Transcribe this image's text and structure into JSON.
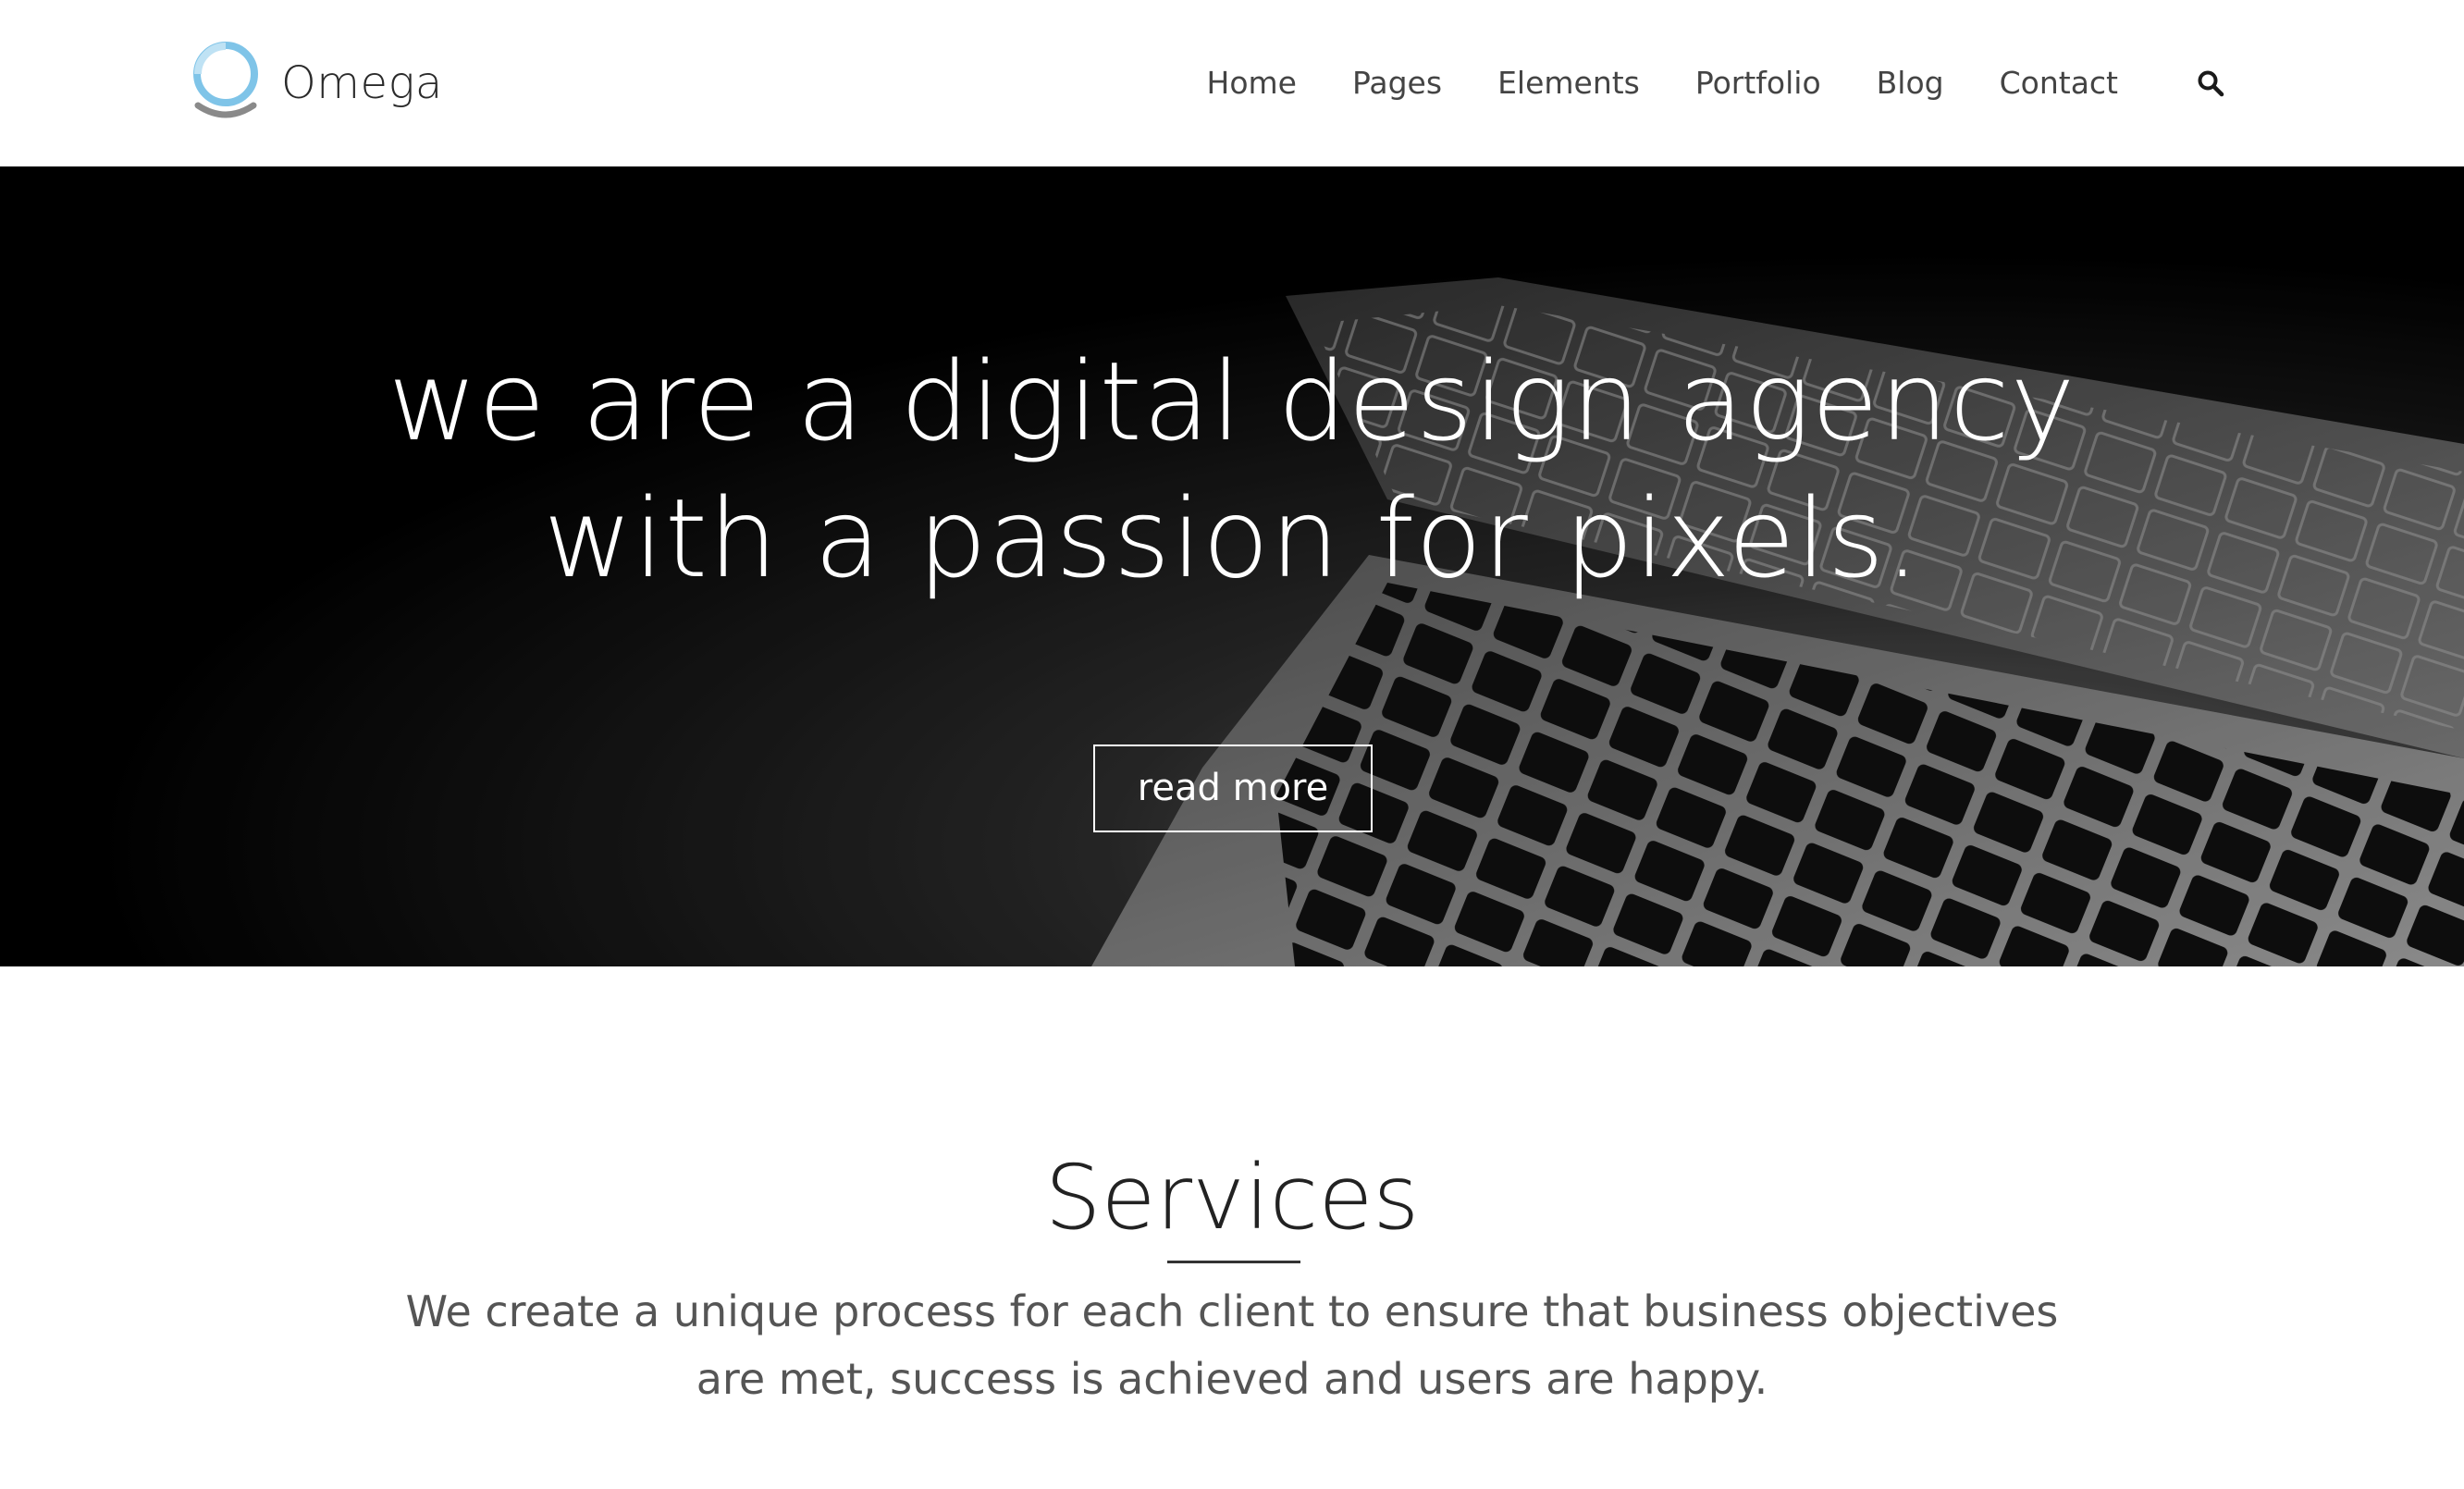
{
  "brand": {
    "name": "Omega",
    "ring_color": "#7fc4e8",
    "swoosh_color": "#8a8a8a"
  },
  "nav": {
    "items": [
      {
        "label": "Home"
      },
      {
        "label": "Pages"
      },
      {
        "label": "Elements"
      },
      {
        "label": "Portfolio"
      },
      {
        "label": "Blog"
      },
      {
        "label": "Contact"
      }
    ],
    "search_icon": "search-icon"
  },
  "hero": {
    "title_line1": "we are a digital design agency",
    "title_line2": "with a passion for pixels.",
    "button_label": "read more",
    "background": "laptop-keyboard-photo"
  },
  "services": {
    "title": "Services",
    "text_line1": "We create a unique process for each client to ensure that business objectives",
    "text_line2": "are met, success is achieved and users are happy."
  }
}
